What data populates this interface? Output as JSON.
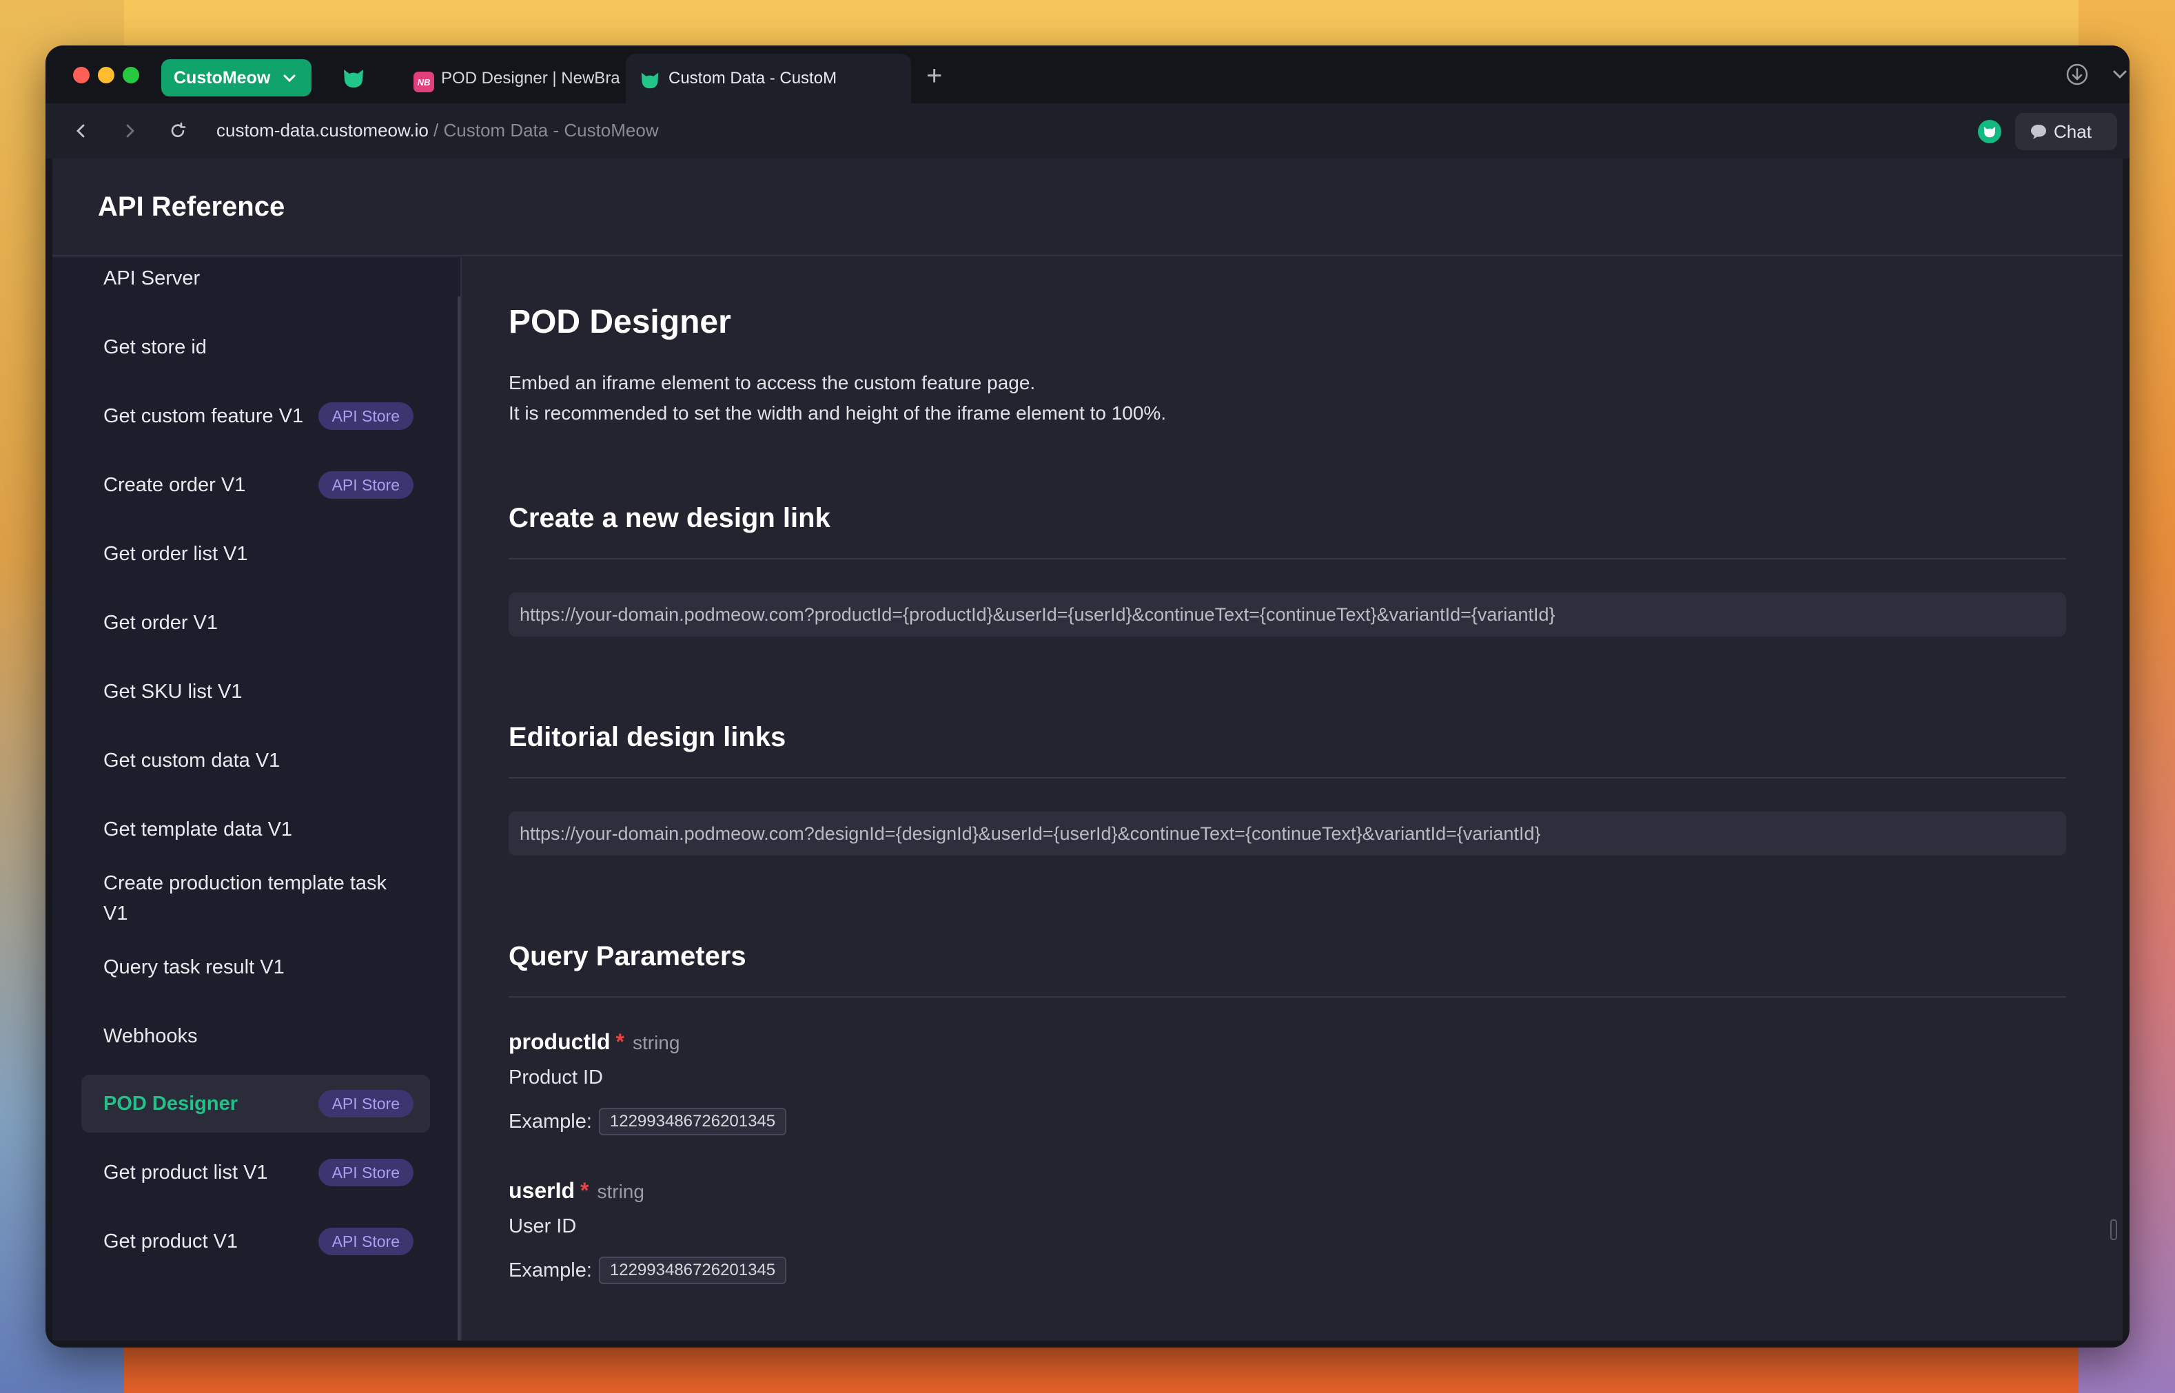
{
  "browser": {
    "workspace_label": "CustoMeow",
    "tabs": [
      {
        "label": "POD Designer | NewBra"
      },
      {
        "label": "Custom Data - CustoM"
      }
    ],
    "url_domain": "custom-data.customeow.io",
    "url_sep": "/",
    "url_title": "Custom Data - CustoMeow",
    "chat_label": "Chat"
  },
  "page": {
    "title": "API Reference"
  },
  "sidebar": {
    "items": [
      {
        "label": "API Server"
      },
      {
        "label": "Get store id"
      },
      {
        "label": "Get custom feature V1",
        "badge": "API Store"
      },
      {
        "label": "Create order V1",
        "badge": "API Store"
      },
      {
        "label": "Get order list V1"
      },
      {
        "label": "Get order V1"
      },
      {
        "label": "Get SKU list V1"
      },
      {
        "label": "Get custom data V1"
      },
      {
        "label": "Get template data V1"
      },
      {
        "label": "Create production template task V1"
      },
      {
        "label": "Query task result V1"
      },
      {
        "label": "Webhooks"
      },
      {
        "label": "POD Designer",
        "badge": "API Store",
        "active": true
      },
      {
        "label": "Get product list V1",
        "badge": "API Store"
      },
      {
        "label": "Get product V1",
        "badge": "API Store"
      }
    ]
  },
  "content": {
    "heading": "POD Designer",
    "desc_line1": "Embed an iframe element to access the custom feature page.",
    "desc_line2": "It is recommended to set the width and height of the iframe element to 100%.",
    "section_create": "Create a new design link",
    "create_url": "https://your-domain.podmeow.com?productId={productId}&userId={userId}&continueText={continueText}&variantId={variantId}",
    "section_edit": "Editorial design links",
    "edit_url": "https://your-domain.podmeow.com?designId={designId}&userId={userId}&continueText={continueText}&variantId={variantId}",
    "section_query": "Query Parameters",
    "params": [
      {
        "name": "productId",
        "required": "*",
        "type": "string",
        "desc": "Product ID",
        "example_label": "Example:",
        "example": "122993486726201345"
      },
      {
        "name": "userId",
        "required": "*",
        "type": "string",
        "desc": "User ID",
        "example_label": "Example:",
        "example": "122993486726201345"
      }
    ]
  },
  "colors": {
    "accent_green": "#11a36c",
    "active_nav": "#24c08a",
    "badge_bg": "#3c3570",
    "badge_text": "#a8a0f0",
    "required": "#e64545"
  }
}
